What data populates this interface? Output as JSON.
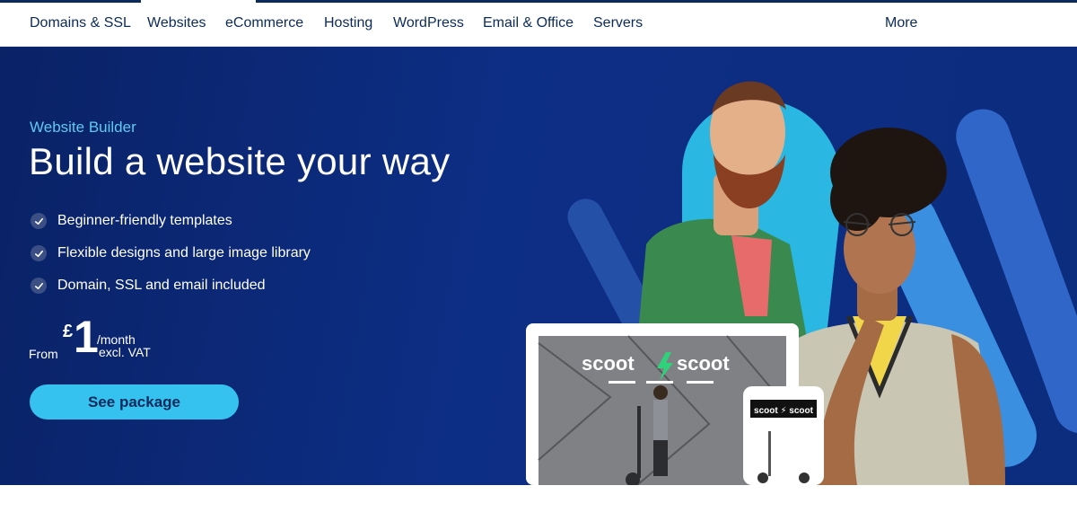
{
  "nav": {
    "items": [
      "Domains & SSL",
      "Websites",
      "eCommerce",
      "Hosting",
      "WordPress",
      "Email & Office",
      "Servers"
    ],
    "more_label": "More",
    "active": "Websites"
  },
  "hero": {
    "eyebrow": "Website Builder",
    "headline": "Build a website your way",
    "features": [
      "Beginner-friendly templates",
      "Flexible designs and large image library",
      "Domain, SSL and email included"
    ],
    "price": {
      "from": "From",
      "currency": "£",
      "amount": "1",
      "period": "/month",
      "vat": "excl. VAT"
    },
    "cta_label": "See package",
    "mockup": {
      "laptop_brand_left": "scoot",
      "laptop_brand_right": "scoot",
      "phone_brand": "scoot ⚡ scoot"
    }
  },
  "colors": {
    "nav_text": "#0b2a5b",
    "hero_bg": "#0d2e85",
    "accent": "#35c2ee",
    "eyebrow": "#5fcaf0"
  }
}
